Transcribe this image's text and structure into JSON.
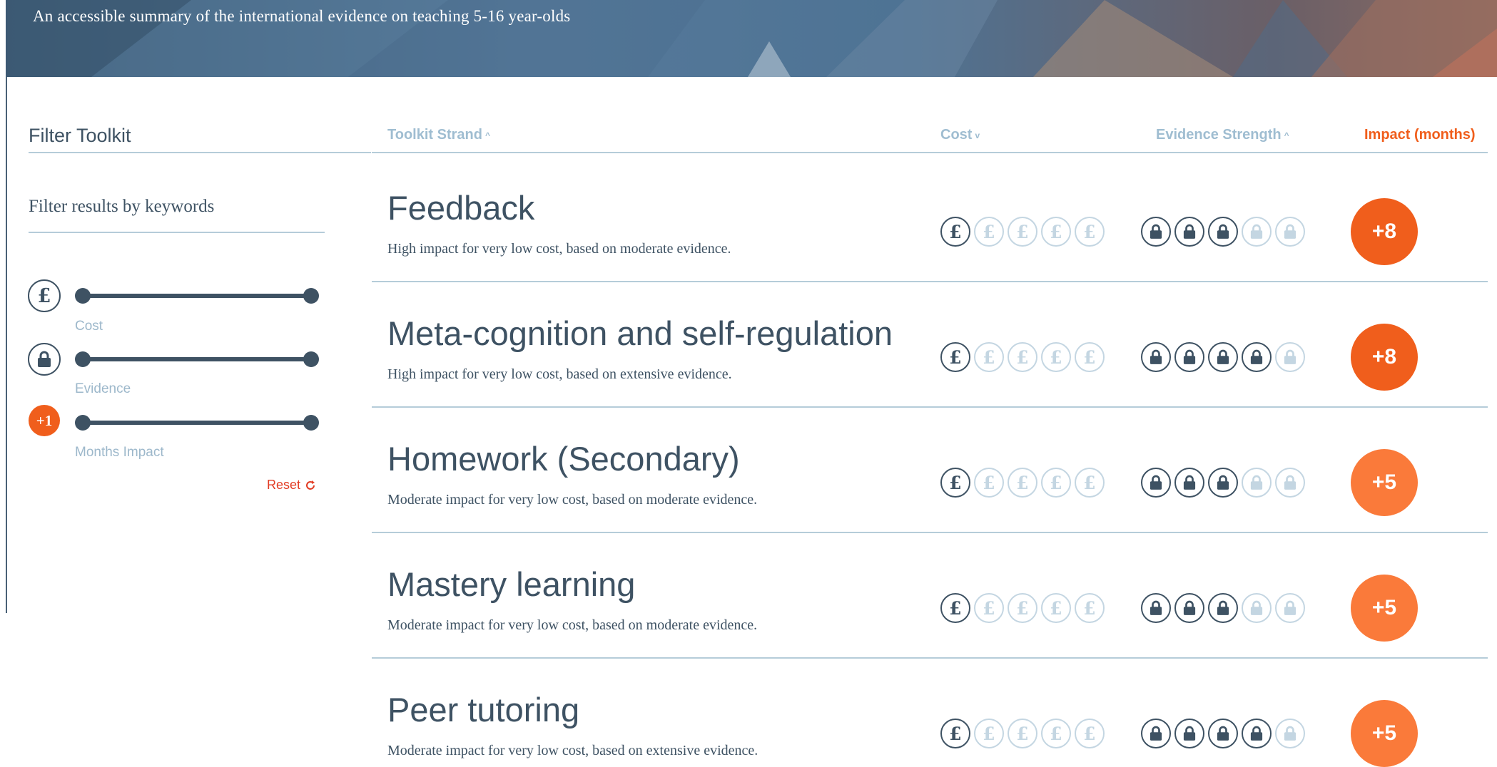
{
  "banner": {
    "subtitle": "An accessible summary of the international evidence on teaching 5-16 year-olds"
  },
  "sidebar": {
    "title": "Filter Toolkit",
    "keywords_label": "Filter results by keywords",
    "filters": [
      {
        "icon": "pound-icon",
        "caption": "Cost"
      },
      {
        "icon": "lock-icon",
        "caption": "Evidence"
      },
      {
        "icon": "impact-badge-icon",
        "badge": "+1",
        "caption": "Months Impact"
      }
    ],
    "reset_label": "Reset"
  },
  "table": {
    "headers": {
      "strand": "Toolkit Strand",
      "cost": "Cost",
      "evidence": "Evidence Strength",
      "impact": "Impact (months)"
    },
    "rows": [
      {
        "title": "Feedback",
        "description": "High impact for very low cost, based on moderate evidence.",
        "cost": 1,
        "evidence": 3,
        "impact": "+8"
      },
      {
        "title": "Meta-cognition and self-regulation",
        "description": "High impact for very low cost, based on extensive evidence.",
        "cost": 1,
        "evidence": 4,
        "impact": "+8"
      },
      {
        "title": "Homework (Secondary)",
        "description": "Moderate impact for very low cost, based on moderate evidence.",
        "cost": 1,
        "evidence": 3,
        "impact": "+5"
      },
      {
        "title": "Mastery learning",
        "description": "Moderate impact for very low cost, based on moderate evidence.",
        "cost": 1,
        "evidence": 3,
        "impact": "+5"
      },
      {
        "title": "Peer tutoring",
        "description": "Moderate impact for very low cost, based on extensive evidence.",
        "cost": 1,
        "evidence": 4,
        "impact": "+5"
      }
    ]
  },
  "colors": {
    "accent_orange": "#f05e1c",
    "accent_orange_light": "#fa7a3a",
    "navy": "#3e5263",
    "muted": "#c4d6e2",
    "reset_red": "#e23c24"
  }
}
